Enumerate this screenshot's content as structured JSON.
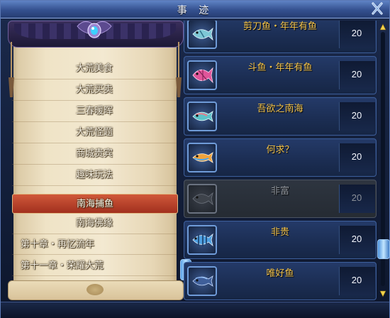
{
  "window": {
    "title": "事 迹"
  },
  "menu": {
    "items": [
      {
        "label": "大荒美食"
      },
      {
        "label": "大荒买卖"
      },
      {
        "label": "三春暖晖"
      },
      {
        "label": "大荒怪题"
      },
      {
        "label": "商城贵宾"
      },
      {
        "label": "趣味玩法"
      },
      {
        "label": "南海捕鱼"
      },
      {
        "label": "南海佛缘"
      },
      {
        "label": "第十章・再忆流年"
      },
      {
        "label": "第十一章・荣耀大荒"
      }
    ],
    "selected": "南海捕鱼"
  },
  "fish_list": {
    "rows": [
      {
        "name": "剪刀鱼・年年有鱼",
        "count": "20",
        "state": "active",
        "icon": "fish-icon",
        "color": "#7ec7d6"
      },
      {
        "name": "斗鱼・年年有鱼",
        "count": "20",
        "state": "active",
        "icon": "fish-icon",
        "color": "#e0559a"
      },
      {
        "name": "吾欲之南海",
        "count": "20",
        "state": "active",
        "icon": "fish-icon",
        "color": "#5ec2c9"
      },
      {
        "name": "何求？",
        "count": "20",
        "state": "active",
        "icon": "fish-icon",
        "color": "#f0a33c"
      },
      {
        "name": "非富",
        "count": "20",
        "state": "inactive",
        "icon": "fish-icon",
        "color": "#6c727c"
      },
      {
        "name": "非贵",
        "count": "20",
        "state": "active",
        "icon": "fish-icon",
        "color": "#4e9fe0"
      },
      {
        "name": "唯好鱼",
        "count": "20",
        "state": "active",
        "icon": "fish-icon",
        "color": "#3f5f9a"
      }
    ]
  },
  "colors": {
    "accent_gold": "#f3c34b",
    "selected_red": "#c04a30",
    "frame_blue": "#3d5f9c"
  }
}
